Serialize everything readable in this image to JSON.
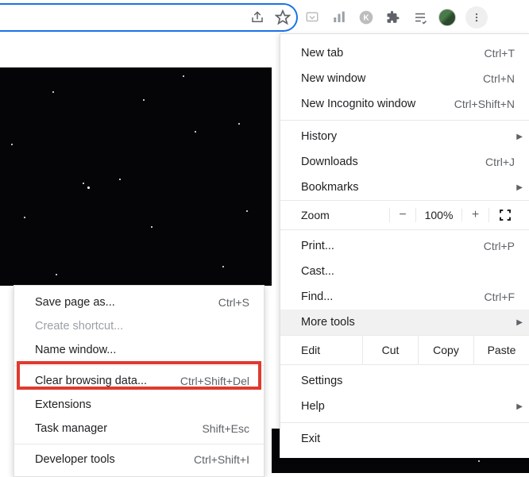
{
  "mainMenu": {
    "newTab": {
      "label": "New tab",
      "shortcut": "Ctrl+T"
    },
    "newWindow": {
      "label": "New window",
      "shortcut": "Ctrl+N"
    },
    "newIncognito": {
      "label": "New Incognito window",
      "shortcut": "Ctrl+Shift+N"
    },
    "history": {
      "label": "History"
    },
    "downloads": {
      "label": "Downloads",
      "shortcut": "Ctrl+J"
    },
    "bookmarks": {
      "label": "Bookmarks"
    },
    "zoom": {
      "label": "Zoom",
      "minus": "−",
      "value": "100%",
      "plus": "+"
    },
    "print": {
      "label": "Print...",
      "shortcut": "Ctrl+P"
    },
    "cast": {
      "label": "Cast..."
    },
    "find": {
      "label": "Find...",
      "shortcut": "Ctrl+F"
    },
    "moreTools": {
      "label": "More tools"
    },
    "edit": {
      "label": "Edit",
      "cut": "Cut",
      "copy": "Copy",
      "paste": "Paste"
    },
    "settings": {
      "label": "Settings"
    },
    "help": {
      "label": "Help"
    },
    "exit": {
      "label": "Exit"
    }
  },
  "subMenu": {
    "savePage": {
      "label": "Save page as...",
      "shortcut": "Ctrl+S"
    },
    "createShortcut": {
      "label": "Create shortcut..."
    },
    "nameWindow": {
      "label": "Name window..."
    },
    "clearBrowsing": {
      "label": "Clear browsing data...",
      "shortcut": "Ctrl+Shift+Del"
    },
    "extensions": {
      "label": "Extensions"
    },
    "taskManager": {
      "label": "Task manager",
      "shortcut": "Shift+Esc"
    },
    "devTools": {
      "label": "Developer tools",
      "shortcut": "Ctrl+Shift+I"
    }
  }
}
